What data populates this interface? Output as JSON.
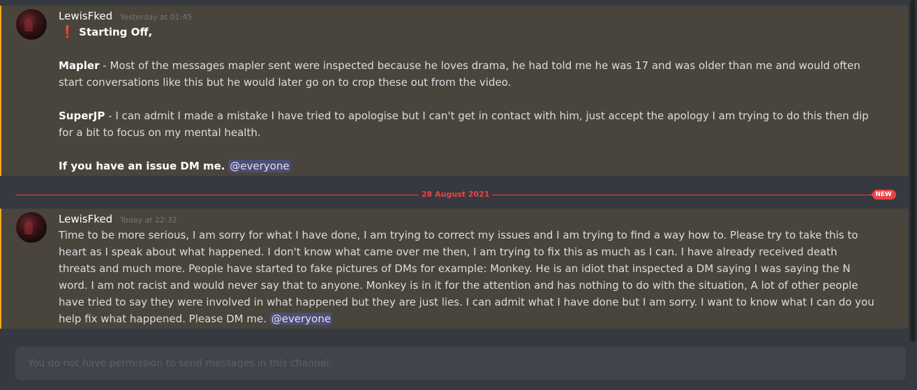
{
  "messages": [
    {
      "username": "LewisFked",
      "timestamp": "Yesterday at 01:45",
      "heading": "Starting Off,",
      "mapler_name": "Mapler",
      "mapler_text": " - Most of the messages mapler sent were inspected because he loves drama, he had told me he was 17 and was older than me and would often start conversations like this but he would later go on to crop these out from the video.",
      "superjp_name": "SuperJP",
      "superjp_text": " - I can admit I made a mistake I have tried to apologise but I can't get in contact with him, just accept the apology I am trying to do this then dip for a bit to focus on my mental health.",
      "closing": "If you have an issue DM me.",
      "mention": "@everyone"
    },
    {
      "username": "LewisFked",
      "timestamp": "Today at 22:32",
      "body": "Time to be more serious, I am sorry for what I have done, I am trying to correct my issues and I am trying to find a way how to. Please try to take this to heart as I speak about what happened. I don't know what came over me then, I am trying to fix this as much as I can. I have already received death threats and much more. People have started to fake pictures of DMs for example: Monkey. He is an idiot that inspected a DM saying I was saying the N word. I am not racist and would never say that to anyone. Monkey is in it for the attention and has nothing to do with the situation, A lot of other people have tried to say they were involved in what happened but they are just lies. I can admit what I have done but I am sorry. I want to know what I can do you help fix what happened. Please DM me.",
      "mention": "@everyone"
    }
  ],
  "divider": {
    "date": "28 August 2021",
    "badge": "NEW"
  },
  "composer": {
    "placeholder": "You do not have permission to send messages in this channel."
  },
  "colors": {
    "background": "#36393f",
    "highlight": "#49443c",
    "highlight_border": "#faa81a",
    "new_divider": "#ed4245",
    "mention_bg": "#5865f2"
  },
  "icons": {
    "exclamation": "red-exclamation-emoji-icon"
  }
}
